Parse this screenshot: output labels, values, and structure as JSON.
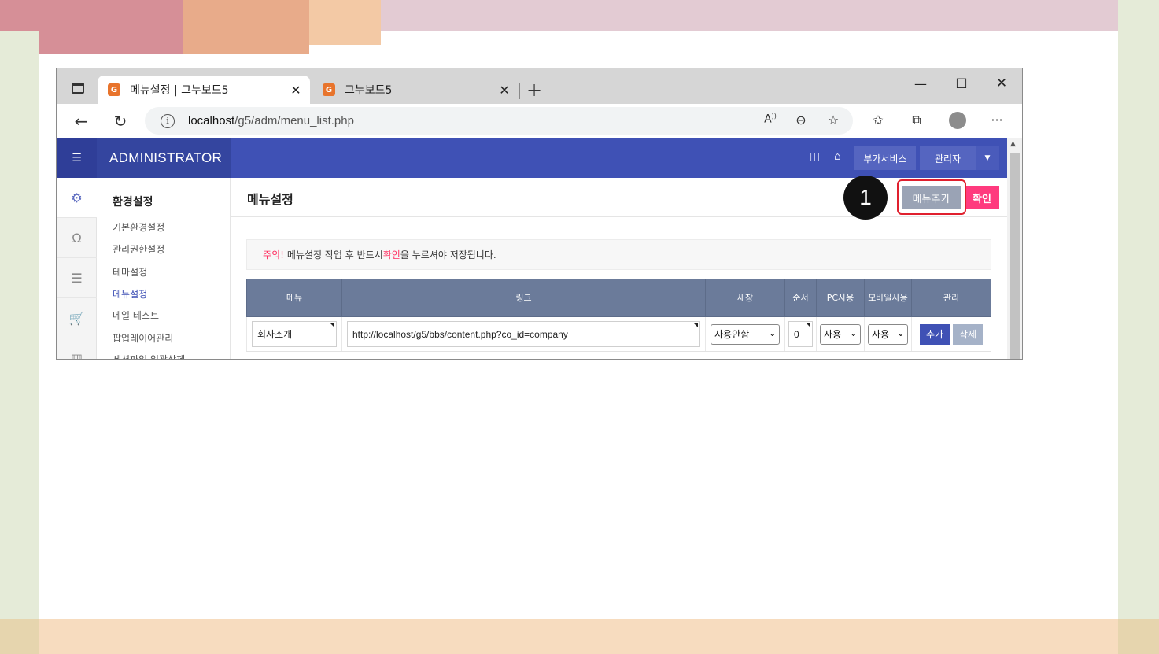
{
  "browser": {
    "tabs": [
      {
        "title": "메뉴설정 | 그누보드5",
        "active": true
      },
      {
        "title": "그누보드5",
        "active": false
      }
    ],
    "favicon_text": "G",
    "url_host": "localhost",
    "url_path": "/g5/adm/menu_list.php",
    "icons": [
      "tab-actions-icon",
      "close-icon",
      "new-tab-icon",
      "minimize-icon",
      "maximize-icon",
      "close-window-icon",
      "back-icon",
      "refresh-icon",
      "info-icon",
      "read-aloud-icon",
      "zoom-out-icon",
      "favorite-add-icon",
      "favorites-icon",
      "collections-icon",
      "profile-icon",
      "more-icon"
    ]
  },
  "admin": {
    "brand": "ADMINISTRATOR",
    "top_buttons": {
      "addons": "부가서비스",
      "admin": "관리자"
    },
    "sidebar": {
      "title": "환경설정",
      "items": [
        "기본환경설정",
        "관리권한설정",
        "테마설정",
        "메뉴설정",
        "메일 테스트",
        "팝업레이어관리",
        "세션파일 일괄삭제"
      ]
    },
    "page_title": "메뉴설정",
    "buttons": {
      "add_menu": "메뉴추가",
      "confirm": "확인"
    },
    "step_number": "1",
    "notice": {
      "warn": "주의!",
      "part1": "메뉴설정 작업 후 반드시 ",
      "highlight": "확인",
      "part2": "을 누르셔야 저장됩니다."
    },
    "table": {
      "headers": [
        "메뉴",
        "링크",
        "새창",
        "순서",
        "PC사용",
        "모바일사용",
        "관리"
      ],
      "rows": [
        {
          "menu": "회사소개",
          "link": "http://localhost/g5/bbs/content.php?co_id=company",
          "new_window": "사용안함",
          "order": "0",
          "pc_use": "사용",
          "mobile_use": "사용",
          "add": "추가",
          "delete": "삭제"
        }
      ]
    }
  },
  "colors": {
    "nav": "#3f51b5",
    "accent_pink": "#ff3a7e",
    "header_gray": "#6b7b9a",
    "highlight_box": "#e0202e"
  }
}
